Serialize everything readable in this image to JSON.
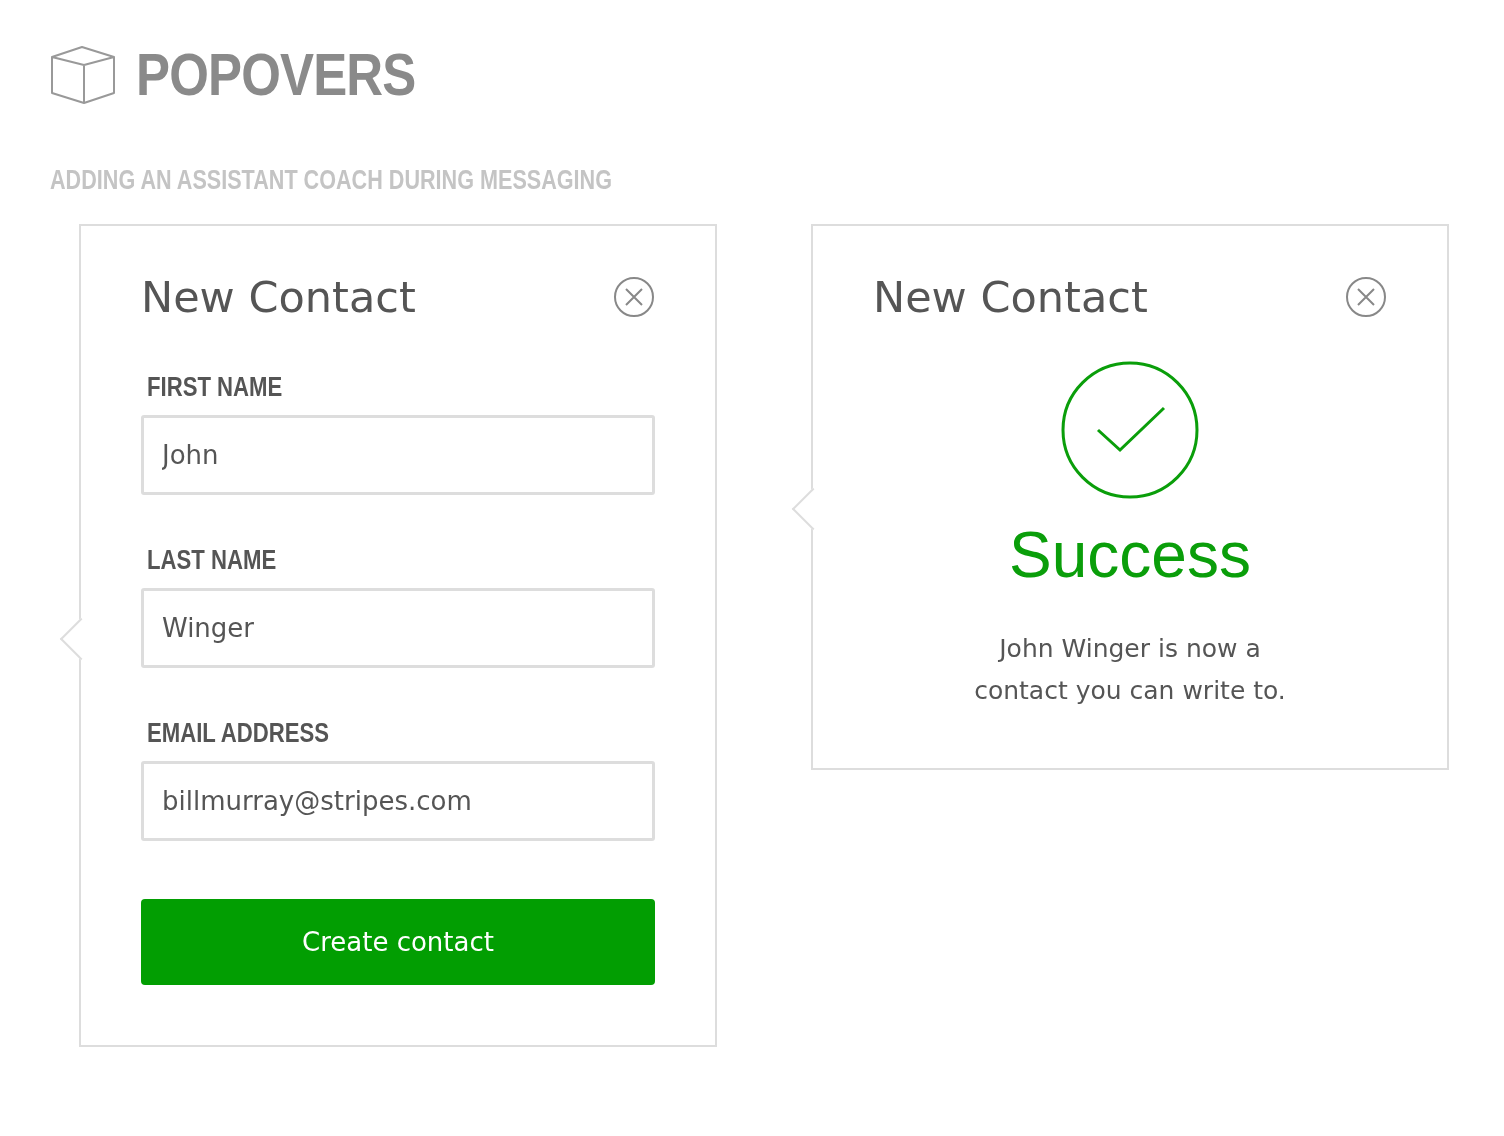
{
  "header": {
    "title": "POPOVERS",
    "subtitle": "ADDING AN ASSISTANT COACH DURING MESSAGING"
  },
  "popovers": [
    {
      "kind": "form",
      "title": "New Contact",
      "fields": [
        {
          "label": "FIRST NAME",
          "value": "John"
        },
        {
          "label": "LAST NAME",
          "value": "Winger"
        },
        {
          "label": "EMAIL ADDRESS",
          "value": "billmurray@stripes.com"
        }
      ],
      "button": "Create contact"
    },
    {
      "kind": "success",
      "title": "New Contact",
      "status": "Success",
      "message": "John Winger is now a contact you can write to."
    }
  ]
}
